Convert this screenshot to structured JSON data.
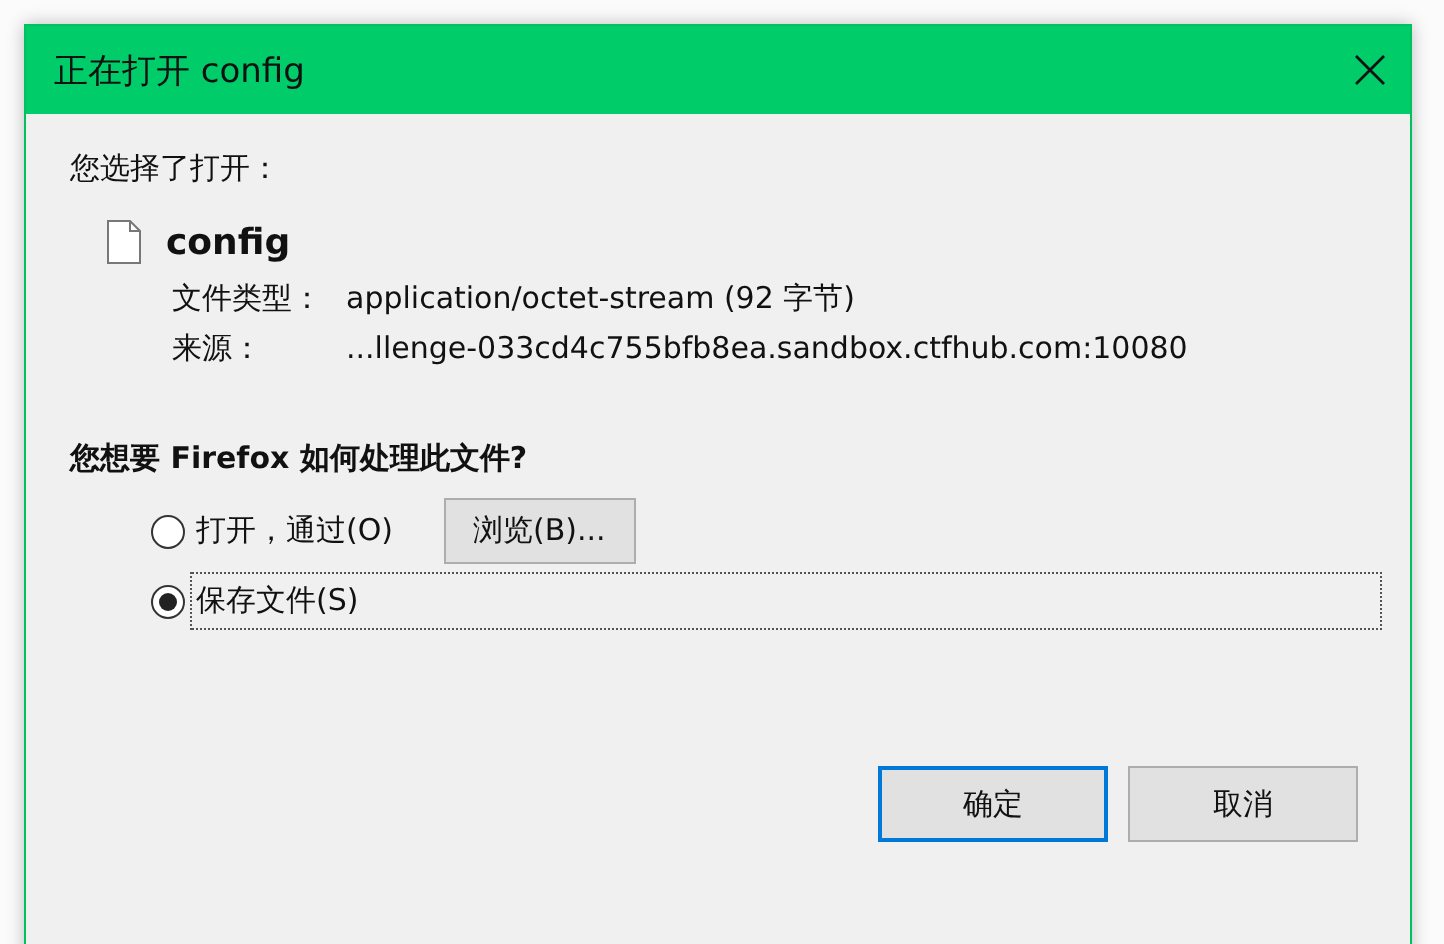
{
  "window": {
    "title": "正在打开 config"
  },
  "intro": "您选择了打开：",
  "file": {
    "name": "config",
    "type_label": "文件类型：",
    "type_value": "application/octet-stream (92 字节)",
    "source_label": "来源：",
    "source_value": "...llenge-033cd4c755bfb8ea.sandbox.ctfhub.com:10080"
  },
  "question": "您想要 Firefox 如何处理此文件?",
  "options": [
    {
      "label": "打开，通过(O)",
      "selected": false,
      "focused": false,
      "button": "浏览(B)..."
    },
    {
      "label": "保存文件(S)",
      "selected": true,
      "focused": true
    }
  ],
  "buttons": [
    {
      "label": "确定",
      "default": true
    },
    {
      "label": "取消",
      "default": false
    }
  ]
}
